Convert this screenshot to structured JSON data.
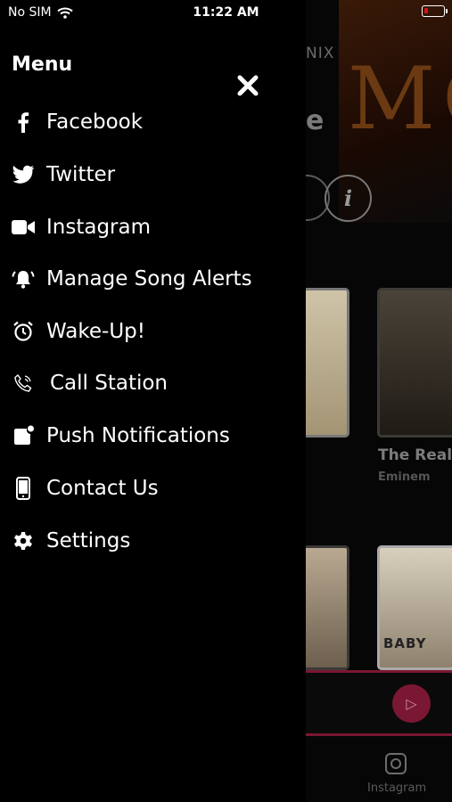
{
  "status_bar": {
    "carrier": "No SIM",
    "time": "11:22 AM"
  },
  "drawer": {
    "title": "Menu",
    "items": [
      {
        "label": "Facebook",
        "icon": "facebook-icon"
      },
      {
        "label": "Twitter",
        "icon": "twitter-icon"
      },
      {
        "label": "Instagram",
        "icon": "video-camera-icon"
      },
      {
        "label": "Manage Song Alerts",
        "icon": "alarm-bell-icon"
      },
      {
        "label": "Wake-Up!",
        "icon": "alarm-clock-icon"
      },
      {
        "label": "Call Station",
        "icon": "phone-icon"
      },
      {
        "label": "Push Notifications",
        "icon": "notification-badge-icon"
      },
      {
        "label": "Contact Us",
        "icon": "mobile-phone-icon"
      },
      {
        "label": "Settings",
        "icon": "gear-icon"
      }
    ]
  },
  "background_app": {
    "header_fragment": "NIX",
    "title_fragment": "e",
    "info_button": "i",
    "song_title": "The Real",
    "artist": "Eminem",
    "album_art_text": "BABY",
    "tab_label": "Instagram",
    "tab_label_fragment": "c"
  },
  "colors": {
    "drawer_bg": "#000000",
    "accent": "#7a1733",
    "text": "#ffffff"
  }
}
